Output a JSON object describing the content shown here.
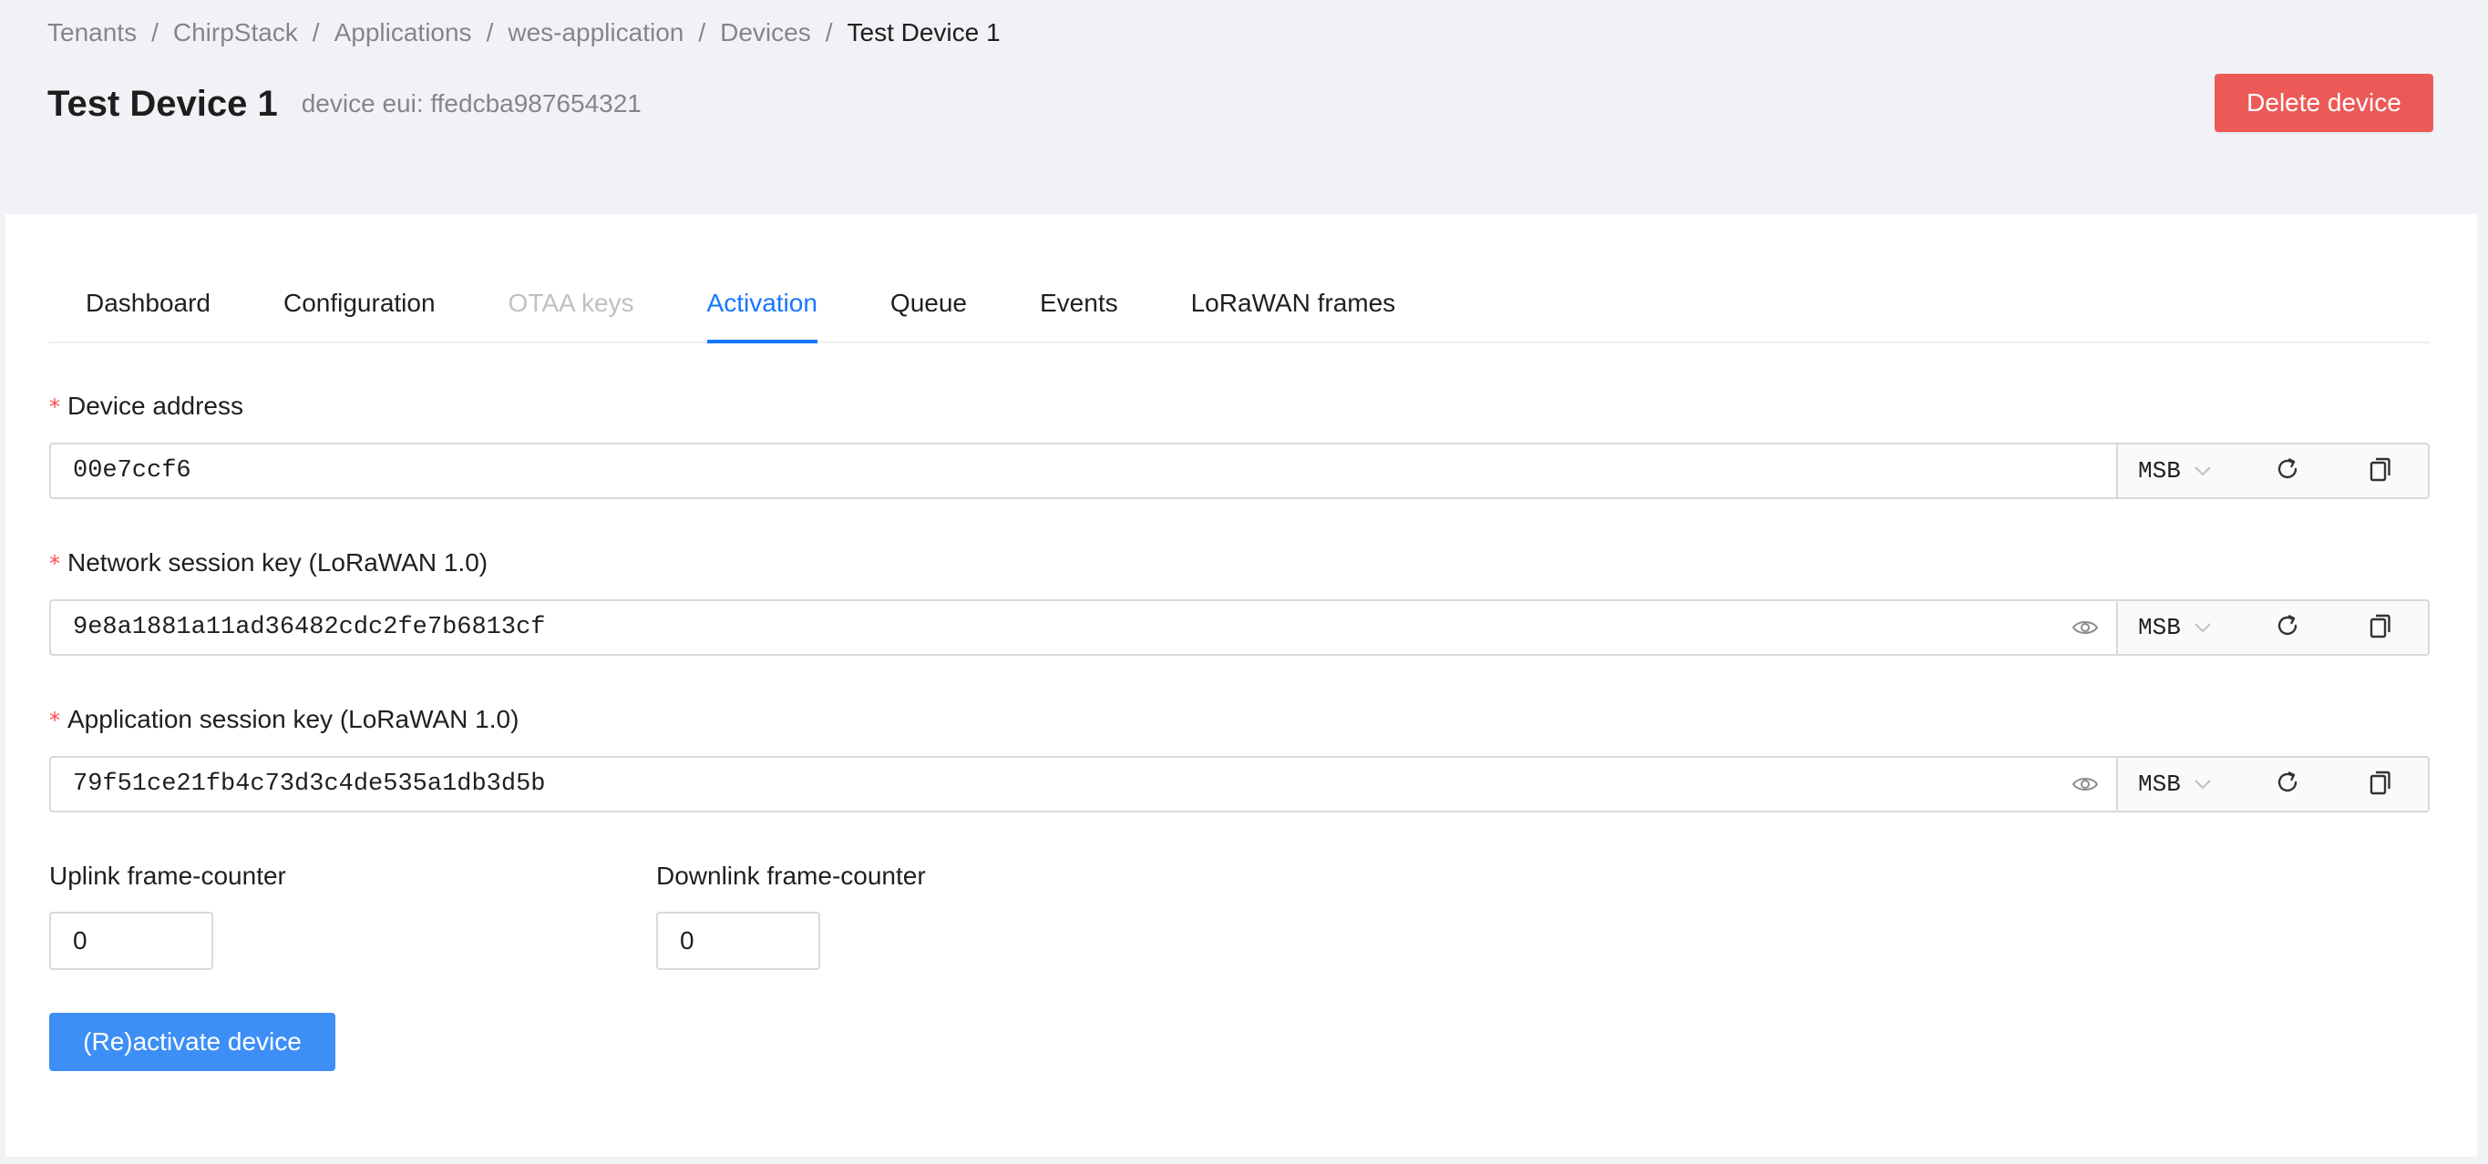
{
  "breadcrumb": {
    "items": [
      "Tenants",
      "ChirpStack",
      "Applications",
      "wes-application",
      "Devices",
      "Test Device 1"
    ],
    "separator": "/"
  },
  "header": {
    "title": "Test Device 1",
    "subtitle": "device eui: ffedcba987654321",
    "delete_label": "Delete device"
  },
  "tabs": [
    {
      "label": "Dashboard",
      "state": "normal"
    },
    {
      "label": "Configuration",
      "state": "normal"
    },
    {
      "label": "OTAA keys",
      "state": "disabled"
    },
    {
      "label": "Activation",
      "state": "active"
    },
    {
      "label": "Queue",
      "state": "normal"
    },
    {
      "label": "Events",
      "state": "normal"
    },
    {
      "label": "LoRaWAN frames",
      "state": "normal"
    }
  ],
  "form": {
    "required_mark": "*",
    "device_address": {
      "label": "Device address",
      "value": "00e7ccf6",
      "byte_order": "MSB"
    },
    "nwk_s_key": {
      "label": "Network session key (LoRaWAN 1.0)",
      "value": "9e8a1881a11ad36482cdc2fe7b6813cf",
      "byte_order": "MSB"
    },
    "app_s_key": {
      "label": "Application session key (LoRaWAN 1.0)",
      "value": "79f51ce21fb4c73d3c4de535a1db3d5b",
      "byte_order": "MSB"
    },
    "uplink_fcnt": {
      "label": "Uplink frame-counter",
      "value": "0"
    },
    "downlink_fcnt": {
      "label": "Downlink frame-counter",
      "value": "0"
    },
    "submit_label": "(Re)activate device"
  },
  "colors": {
    "primary": "#1677ff",
    "danger": "#ec5a58",
    "page_background": "#f0f2f5",
    "required": "#ff4d4f"
  },
  "icons": {
    "visibility": "eye-icon",
    "select_arrow": "chevron-down-icon",
    "generate": "refresh-icon",
    "copy": "copy-icon"
  }
}
